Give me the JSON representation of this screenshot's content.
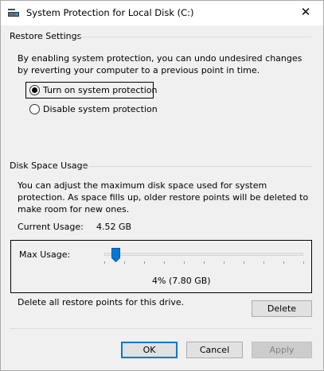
{
  "window": {
    "title": "System Protection for Local Disk (C:)",
    "close_glyph": "✕"
  },
  "restore_settings": {
    "heading": "Restore Settings",
    "description": "By enabling system protection, you can undo undesired changes by reverting your computer to a previous point in time.",
    "options": [
      {
        "label": "Turn on system protection",
        "checked": true
      },
      {
        "label": "Disable system protection",
        "checked": false
      }
    ]
  },
  "disk_space": {
    "heading": "Disk Space Usage",
    "description": "You can adjust the maximum disk space used for system protection. As space fills up, older restore points will be deleted to make room for new ones.",
    "current_usage_label": "Current Usage:",
    "current_usage_value": "4.52 GB",
    "max_usage_label": "Max Usage:",
    "max_usage_value": "4% (7.80 GB)",
    "max_usage_percent": 4,
    "delete_description": "Delete all restore points for this drive.",
    "delete_label": "Delete"
  },
  "footer": {
    "ok_label": "OK",
    "cancel_label": "Cancel",
    "apply_label": "Apply"
  },
  "colors": {
    "accent": "#0078d7",
    "separator": "#dcdcdc"
  }
}
